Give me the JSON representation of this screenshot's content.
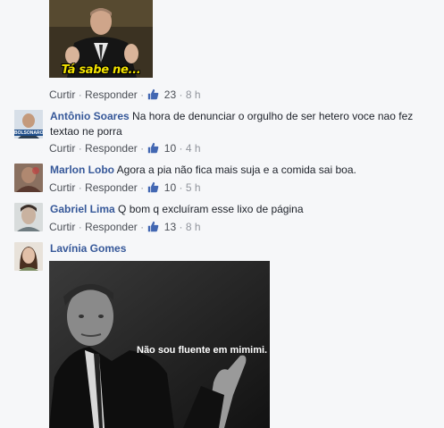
{
  "comments": [
    {
      "actions": {
        "like": "Curtir",
        "reply": "Responder",
        "reactions": "23",
        "time": "8 h"
      }
    },
    {
      "author": "Antônio Soares",
      "text": "Na hora de denunciar o orgulho de ser hetero voce nao fez textao ne porra",
      "avatar_text": "BOLSONARO",
      "actions": {
        "like": "Curtir",
        "reply": "Responder",
        "reactions": "10",
        "time": "4 h"
      }
    },
    {
      "author": "Marlon Lobo",
      "text": "Agora a pia não fica mais suja e a comida sai boa.",
      "actions": {
        "like": "Curtir",
        "reply": "Responder",
        "reactions": "10",
        "time": "5 h"
      }
    },
    {
      "author": "Gabriel Lima",
      "text": "Q bom q excluíram esse lixo de página",
      "actions": {
        "like": "Curtir",
        "reply": "Responder",
        "reactions": "13",
        "time": "8 h"
      }
    },
    {
      "author": "Lavínia Gomes"
    }
  ],
  "images": {
    "meme1_caption": "Tá sabe ne...",
    "meme2_caption": "Não sou fluente em mimimi."
  },
  "separator": "·",
  "colors": {
    "name": "#365899",
    "meta": "#90949c",
    "accent": "#4267b2",
    "background": "#f6f7f9"
  },
  "icons": {
    "like": "thumbs-up-icon"
  }
}
